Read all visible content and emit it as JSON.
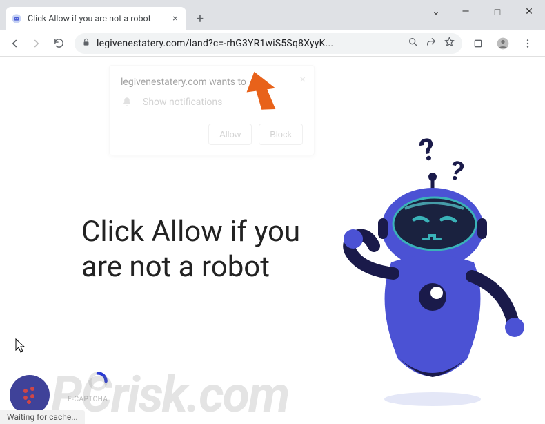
{
  "window": {
    "tab_title": "Click Allow if you are not a robot",
    "dropdown_glyph": "⌄",
    "min_glyph": "—",
    "max_glyph": "□",
    "close_glyph": "✕"
  },
  "toolbar": {
    "url": "legivenestatery.com/land?c=-rhG3YR1wiS5Sq8XyyK..."
  },
  "notification": {
    "origin_text": "legivenestatery.com wants to",
    "permission_text": "Show notifications",
    "allow_label": "Allow",
    "block_label": "Block"
  },
  "page": {
    "headline": "Click Allow if you are not a robot",
    "ecaptcha_label": "E-CAPTCHA"
  },
  "statusbar": {
    "text": "Waiting for cache..."
  },
  "watermark": {
    "text": "PCrisk.com"
  }
}
